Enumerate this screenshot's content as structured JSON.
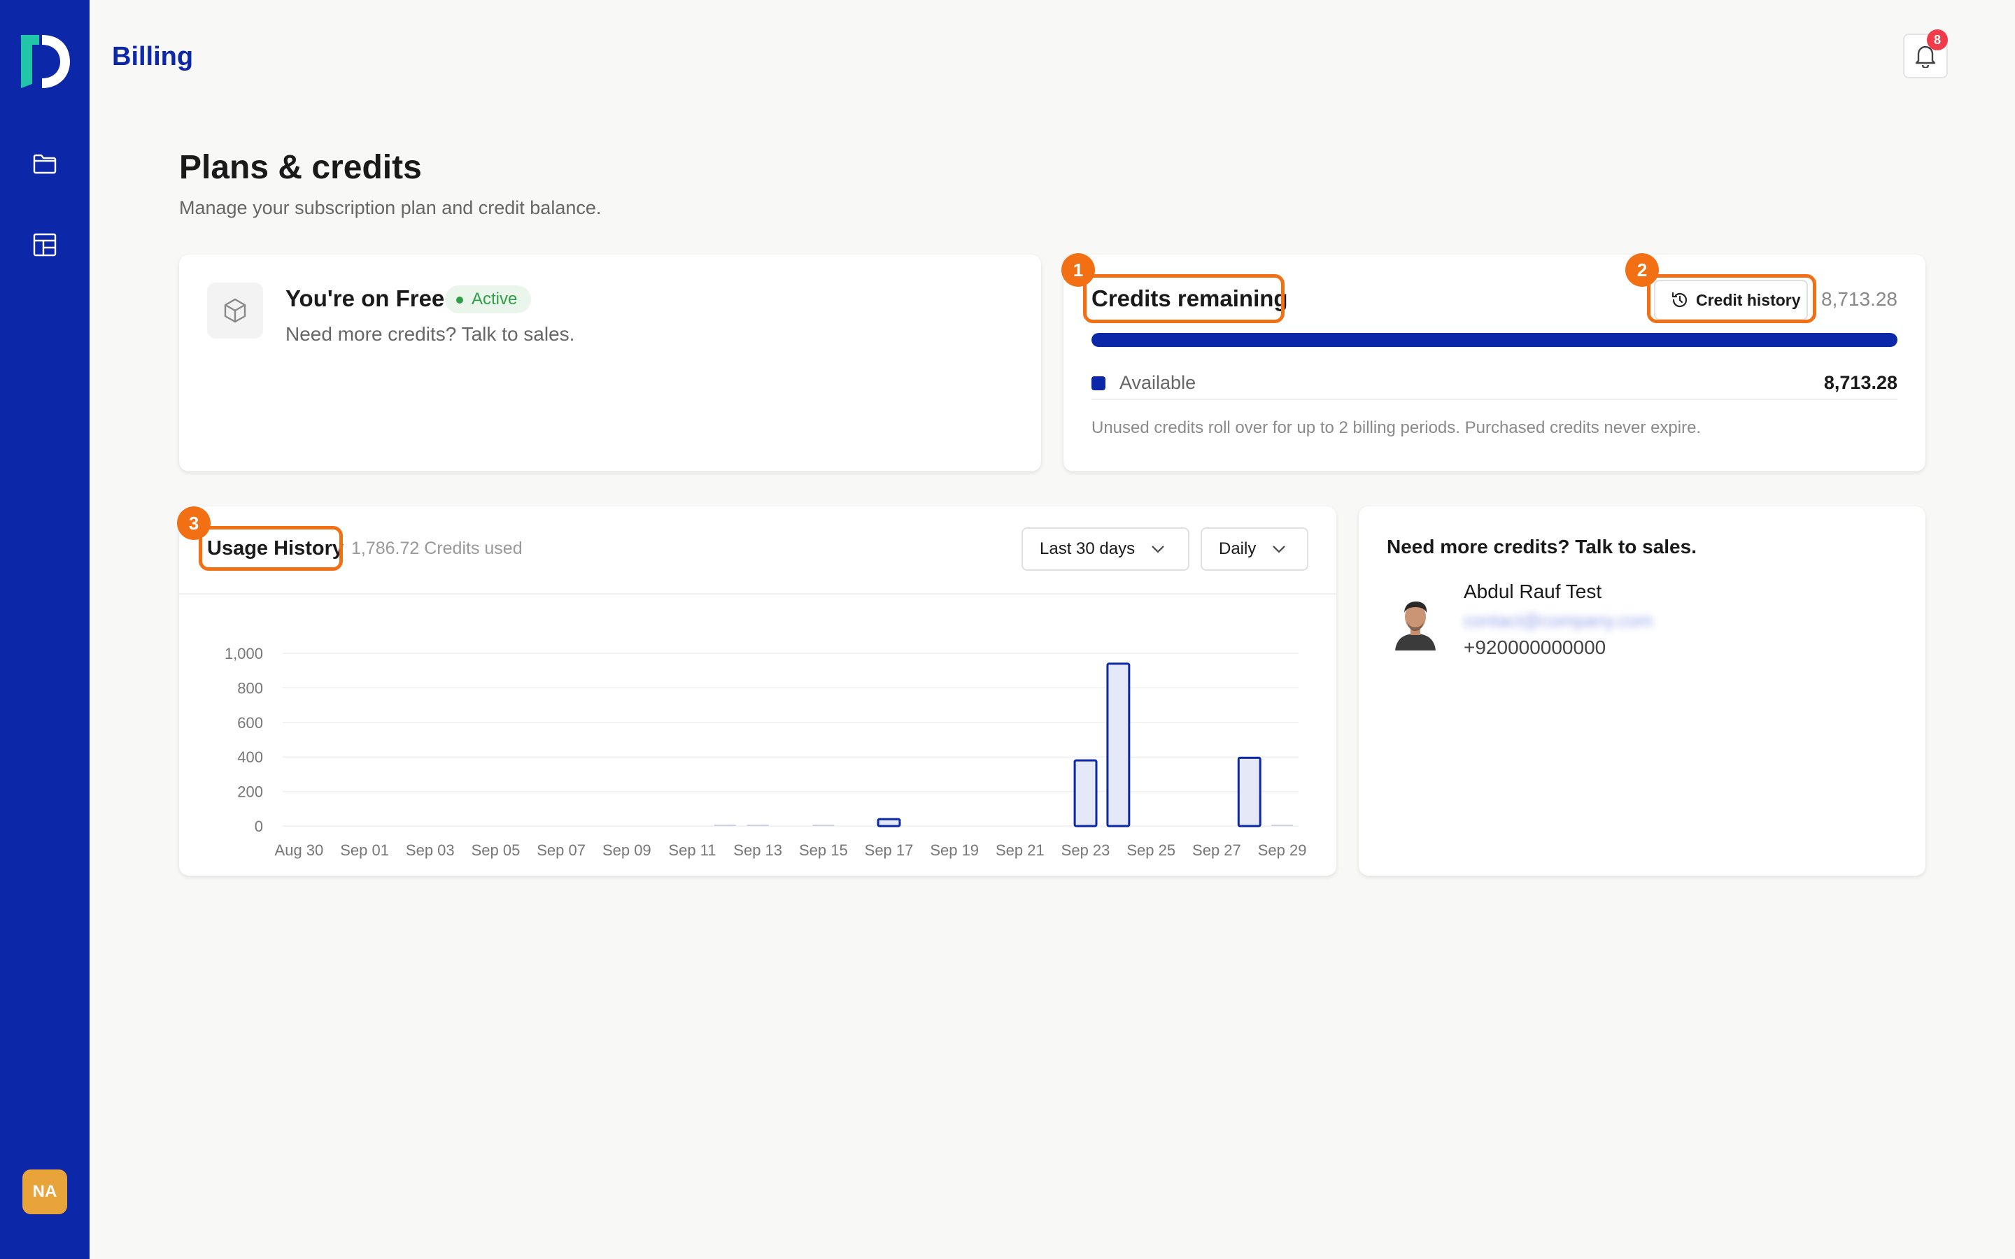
{
  "app": {
    "title": "Billing",
    "logo": "D"
  },
  "sidebar": {
    "items": [
      {
        "name": "folder",
        "icon": "folder-icon"
      },
      {
        "name": "layout",
        "icon": "layout-icon"
      }
    ],
    "user_initials": "NA"
  },
  "header": {
    "notification_count": "8"
  },
  "page": {
    "title": "Plans & credits",
    "subtitle": "Manage your subscription plan and credit balance."
  },
  "plan": {
    "title": "You're on Free",
    "status": "Active",
    "subtitle": "Need more credits? Talk to sales."
  },
  "credits": {
    "title": "Credits remaining",
    "history_label": "Credit history",
    "total": "8,713.28",
    "available_fraction": 1.0,
    "legend_label": "Available",
    "legend_value": "8,713.28",
    "note": "Unused credits roll over for up to 2 billing periods. Purchased credits never expire."
  },
  "usage": {
    "title": "Usage History",
    "summary": "1,786.72 Credits used",
    "range_label": "Last 30 days",
    "granularity_label": "Daily"
  },
  "chart_data": {
    "type": "bar",
    "x": [
      "Aug 30",
      "Aug 31",
      "Sep 01",
      "Sep 02",
      "Sep 03",
      "Sep 04",
      "Sep 05",
      "Sep 06",
      "Sep 07",
      "Sep 08",
      "Sep 09",
      "Sep 10",
      "Sep 11",
      "Sep 12",
      "Sep 13",
      "Sep 14",
      "Sep 15",
      "Sep 16",
      "Sep 17",
      "Sep 18",
      "Sep 19",
      "Sep 20",
      "Sep 21",
      "Sep 22",
      "Sep 23",
      "Sep 24",
      "Sep 25",
      "Sep 26",
      "Sep 27",
      "Sep 28",
      "Sep 29"
    ],
    "tick_labels": [
      "Aug 30",
      "Sep 01",
      "Sep 03",
      "Sep 05",
      "Sep 07",
      "Sep 09",
      "Sep 11",
      "Sep 13",
      "Sep 15",
      "Sep 17",
      "Sep 19",
      "Sep 21",
      "Sep 23",
      "Sep 25",
      "Sep 27",
      "Sep 29"
    ],
    "values": [
      0,
      0,
      0,
      0,
      0,
      0,
      0,
      0,
      0,
      0,
      0,
      0,
      0,
      1,
      1,
      0,
      1,
      0,
      40,
      0,
      0,
      0,
      0,
      0,
      380,
      940,
      0,
      0,
      0,
      395,
      2
    ],
    "yticks": [
      0,
      200,
      400,
      600,
      800,
      1000
    ],
    "yticklabels": [
      "0",
      "200",
      "400",
      "600",
      "800",
      "1,000"
    ],
    "ylim": [
      0,
      1000
    ],
    "grid": true,
    "bar_color": "#0c27a8",
    "bar_fill": "#e4e8f7"
  },
  "sales": {
    "title": "Need more credits? Talk to sales.",
    "contact_name": "Abdul Rauf Test",
    "contact_email": "contact@company.com",
    "contact_phone": "+920000000000"
  },
  "annotations": [
    "1",
    "2",
    "3"
  ],
  "colors": {
    "brand": "#0c27a8",
    "accent": "#f26f14",
    "success": "#2f9e44",
    "badge": "#f03b4a"
  }
}
